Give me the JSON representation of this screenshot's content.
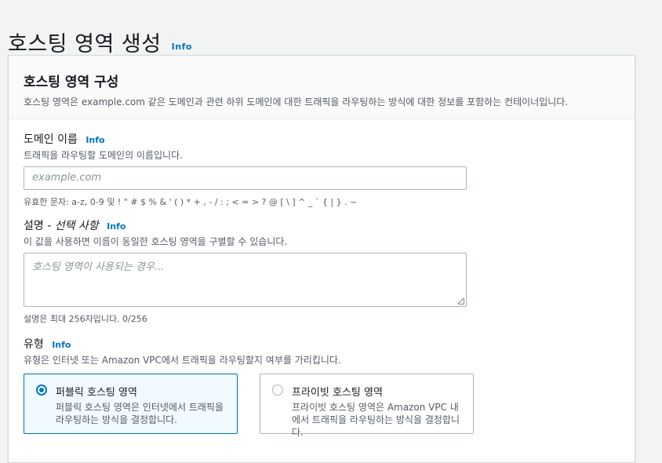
{
  "page": {
    "title": "호스팅 영역 생성",
    "info": "Info"
  },
  "panel": {
    "title": "호스팅 영역 구성",
    "description": "호스팅 영역은 example.com 같은 도메인과 관련 하위 도메인에 대한 트래픽을 라우팅하는 방식에 대한 정보를 포함하는 컨테이너입니다."
  },
  "domain": {
    "label": "도메인 이름",
    "info": "Info",
    "description": "트래픽을 라우팅할 도메인의 이름입니다.",
    "placeholder": "example.com",
    "value": "",
    "constraint": "유효한 문자: a-z, 0-9 및 ! \" # $ % & ' ( ) * + , - / : ; < = > ? @ [ \\ ] ^ _ ` { | } . ~"
  },
  "description_field": {
    "label": "설명 - ",
    "label_optional": "선택 사항",
    "info": "Info",
    "description": "이 값을 사용하면 이름이 동일한 호스팅 영역을 구별할 수 있습니다.",
    "placeholder": "호스팅 영역이 사용되는 경우...",
    "constraint": "설명은 최대 256자입니다. 0/256"
  },
  "type": {
    "label": "유형",
    "info": "Info",
    "description": "유형은 인터넷 또는 Amazon VPC에서 트래픽을 라우팅할지 여부를 가리킵니다.",
    "options": [
      {
        "title": "퍼블릭 호스팅 영역",
        "description": "퍼블릭 호스팅 영역은 인터넷에서 트래픽을 라우팅하는 방식을 결정합니다.",
        "selected": true
      },
      {
        "title": "프라이빗 호스팅 영역",
        "description": "프라이빗 호스팅 영역은 Amazon VPC 내에서 트래픽을 라우팅하는 방식을 결정합니다.",
        "selected": false
      }
    ]
  },
  "colors": {
    "accent": "#0073bb",
    "background": "#f2f3f3",
    "panel": "#ffffff",
    "text_secondary": "#545b64"
  }
}
